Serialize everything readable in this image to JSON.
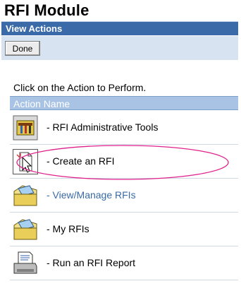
{
  "page": {
    "title": "RFI Module"
  },
  "header": {
    "title": "View Actions"
  },
  "toolbar": {
    "done_label": "Done"
  },
  "instruction": "Click on the Action to Perform.",
  "table": {
    "column_header": "Action Name",
    "rows": [
      {
        "label": "- RFI Administrative Tools",
        "icon": "toolbox-icon",
        "link": false
      },
      {
        "label": "- Create an RFI",
        "icon": "new-document-cursor-icon",
        "link": false
      },
      {
        "label": "- View/Manage RFIs",
        "icon": "folder-icon",
        "link": true
      },
      {
        "label": "- My RFIs",
        "icon": "folder-icon",
        "link": false
      },
      {
        "label": "- Run an RFI Report",
        "icon": "printer-report-icon",
        "link": false
      }
    ]
  },
  "annotation": {
    "highlight_color": "#e0208a",
    "highlighted_row": "Create an RFI"
  },
  "colors": {
    "header_bg": "#3a6aa8",
    "toolbar_bg": "#d7e3f1",
    "column_header_bg": "#a8c3e4",
    "link": "#3a6aa8"
  }
}
